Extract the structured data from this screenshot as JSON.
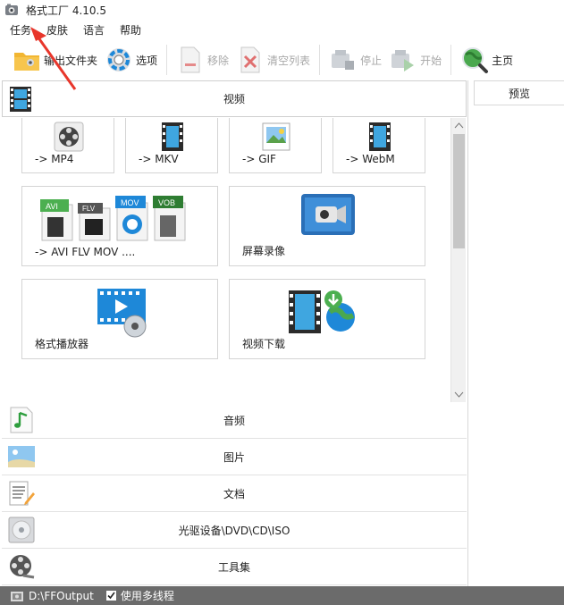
{
  "window": {
    "title": "格式工厂 4.10.5"
  },
  "menu": [
    "任务",
    "皮肤",
    "语言",
    "帮助"
  ],
  "toolbar": {
    "output_folder": "输出文件夹",
    "options": "选项",
    "remove": "移除",
    "clear_list": "清空列表",
    "stop": "停止",
    "start": "开始",
    "home": "主页"
  },
  "categories": {
    "video": "视频",
    "audio": "音频",
    "image": "图片",
    "document": "文档",
    "rom": "光驱设备\\DVD\\CD\\ISO",
    "tools": "工具集"
  },
  "video_tiles": {
    "mp4": "-> MP4",
    "mkv": "-> MKV",
    "gif": "-> GIF",
    "webm": "-> WebM",
    "multi": "-> AVI FLV MOV ....",
    "screen_record": "屏幕录像",
    "player": "格式播放器",
    "downloader": "视频下载",
    "badges": {
      "avi": "AVI",
      "flv": "FLV",
      "mov": "MOV",
      "vob": "VOB"
    }
  },
  "preview": {
    "label": "预览"
  },
  "status": {
    "output_path": "D:\\FFOutput",
    "multithread_label": "使用多线程"
  },
  "colors": {
    "status_bg": "#6b6b6b",
    "annotation_arrow": "#e8362b",
    "accent_blue": "#1e88d8"
  }
}
